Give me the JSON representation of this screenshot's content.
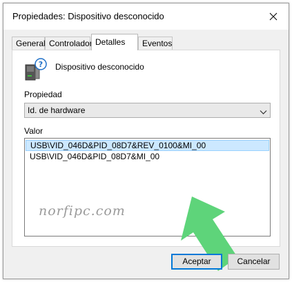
{
  "window": {
    "title": "Propiedades: Dispositivo desconocido",
    "close_icon": "close-icon"
  },
  "tabs": [
    {
      "label": "General",
      "active": false
    },
    {
      "label": "Controlador",
      "active": false
    },
    {
      "label": "Detalles",
      "active": true
    },
    {
      "label": "Eventos",
      "active": false
    }
  ],
  "device": {
    "icon": "unknown-device-icon",
    "name": "Dispositivo desconocido"
  },
  "property": {
    "label": "Propiedad",
    "selected_value": "Id. de hardware"
  },
  "value": {
    "label": "Valor",
    "items": [
      {
        "text": "USB\\VID_046D&PID_08D7&REV_0100&MI_00",
        "selected": true
      },
      {
        "text": "USB\\VID_046D&PID_08D7&MI_00",
        "selected": false
      }
    ]
  },
  "watermark": "norfipc.com",
  "buttons": {
    "ok": "Aceptar",
    "cancel": "Cancelar"
  },
  "colors": {
    "selection_bg": "#cce8ff",
    "selection_border": "#99d1ff",
    "accent": "#0078d7",
    "arrow_green": "#5ed47a"
  }
}
